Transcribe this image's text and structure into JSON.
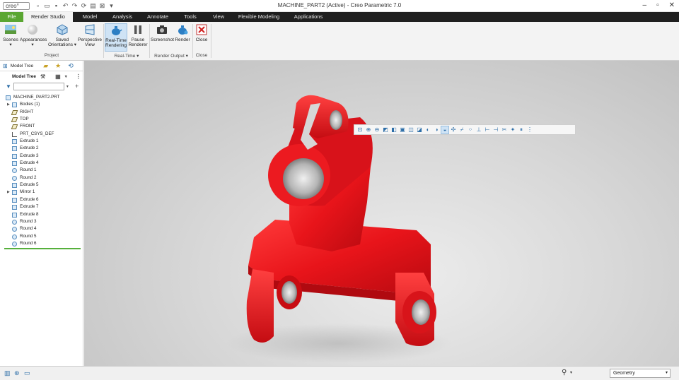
{
  "app": {
    "logo_text": "creo°",
    "window_title": "MACHINE_PART2 (Active) - Creo Parametric 7.0"
  },
  "menu_tabs": [
    {
      "label": "File"
    },
    {
      "label": "Render Studio"
    },
    {
      "label": "Model"
    },
    {
      "label": "Analysis"
    },
    {
      "label": "Annotate"
    },
    {
      "label": "Tools"
    },
    {
      "label": "View"
    },
    {
      "label": "Flexible Modeling"
    },
    {
      "label": "Applications"
    }
  ],
  "ribbon": {
    "buttons": [
      {
        "label": "Scenes",
        "icon": "scenes-icon"
      },
      {
        "label": "Appearances",
        "icon": "appearances-icon"
      },
      {
        "label": "Saved Orientations",
        "icon": "saved-orientations-icon"
      },
      {
        "label": "Perspective View",
        "icon": "perspective-view-icon"
      },
      {
        "label": "Real-Time Rendering",
        "icon": "real-time-rendering-icon"
      },
      {
        "label": "Pause Renderer",
        "icon": "pause-icon"
      },
      {
        "label": "Screenshot",
        "icon": "camera-icon"
      },
      {
        "label": "Render",
        "icon": "render-teapot-icon"
      },
      {
        "label": "Close",
        "icon": "close-x-icon"
      }
    ],
    "groups": [
      {
        "label": "Project"
      },
      {
        "label": "Real-Time"
      },
      {
        "label": "Render Output"
      },
      {
        "label": "Close"
      }
    ]
  },
  "panel": {
    "tab_label": "Model Tree",
    "header_label": "Model Tree",
    "tree": [
      {
        "label": "MACHINE_PART2.PRT",
        "icon": "part-icon",
        "expandable": false,
        "indent": 0
      },
      {
        "label": "Bodies (1)",
        "icon": "bodies-icon",
        "expandable": true,
        "indent": 1
      },
      {
        "label": "RIGHT",
        "icon": "datum-plane-icon",
        "expandable": false,
        "indent": 1
      },
      {
        "label": "TOP",
        "icon": "datum-plane-icon",
        "expandable": false,
        "indent": 1
      },
      {
        "label": "FRONT",
        "icon": "datum-plane-icon",
        "expandable": false,
        "indent": 1
      },
      {
        "label": "PRT_CSYS_DEF",
        "icon": "csys-icon",
        "expandable": false,
        "indent": 1
      },
      {
        "label": "Extrude 1",
        "icon": "extrude-icon",
        "expandable": false,
        "indent": 1
      },
      {
        "label": "Extrude 2",
        "icon": "extrude-icon",
        "expandable": false,
        "indent": 1
      },
      {
        "label": "Extrude 3",
        "icon": "extrude-icon",
        "expandable": false,
        "indent": 1
      },
      {
        "label": "Extrude 4",
        "icon": "extrude-icon",
        "expandable": false,
        "indent": 1
      },
      {
        "label": "Round 1",
        "icon": "round-icon",
        "expandable": false,
        "indent": 1
      },
      {
        "label": "Round 2",
        "icon": "round-icon",
        "expandable": false,
        "indent": 1
      },
      {
        "label": "Extrude 5",
        "icon": "extrude-icon",
        "expandable": false,
        "indent": 1
      },
      {
        "label": "Mirror 1",
        "icon": "mirror-icon",
        "expandable": true,
        "indent": 1
      },
      {
        "label": "Extrude 6",
        "icon": "extrude-icon",
        "expandable": false,
        "indent": 1
      },
      {
        "label": "Extrude 7",
        "icon": "extrude-icon",
        "expandable": false,
        "indent": 1
      },
      {
        "label": "Extrude 8",
        "icon": "extrude-icon",
        "expandable": false,
        "indent": 1
      },
      {
        "label": "Round 3",
        "icon": "round-icon",
        "expandable": false,
        "indent": 1
      },
      {
        "label": "Round 4",
        "icon": "round-icon",
        "expandable": false,
        "indent": 1
      },
      {
        "label": "Round 5",
        "icon": "round-icon",
        "expandable": false,
        "indent": 1
      },
      {
        "label": "Round 6",
        "icon": "round-icon",
        "expandable": false,
        "indent": 1
      }
    ]
  },
  "status": {
    "filter_value": "Geometry"
  },
  "colors": {
    "file_tab": "#5aa632",
    "tab_bar": "#1f1f1f",
    "part_red": "#e8141a",
    "highlight": "#cfe3f5"
  }
}
